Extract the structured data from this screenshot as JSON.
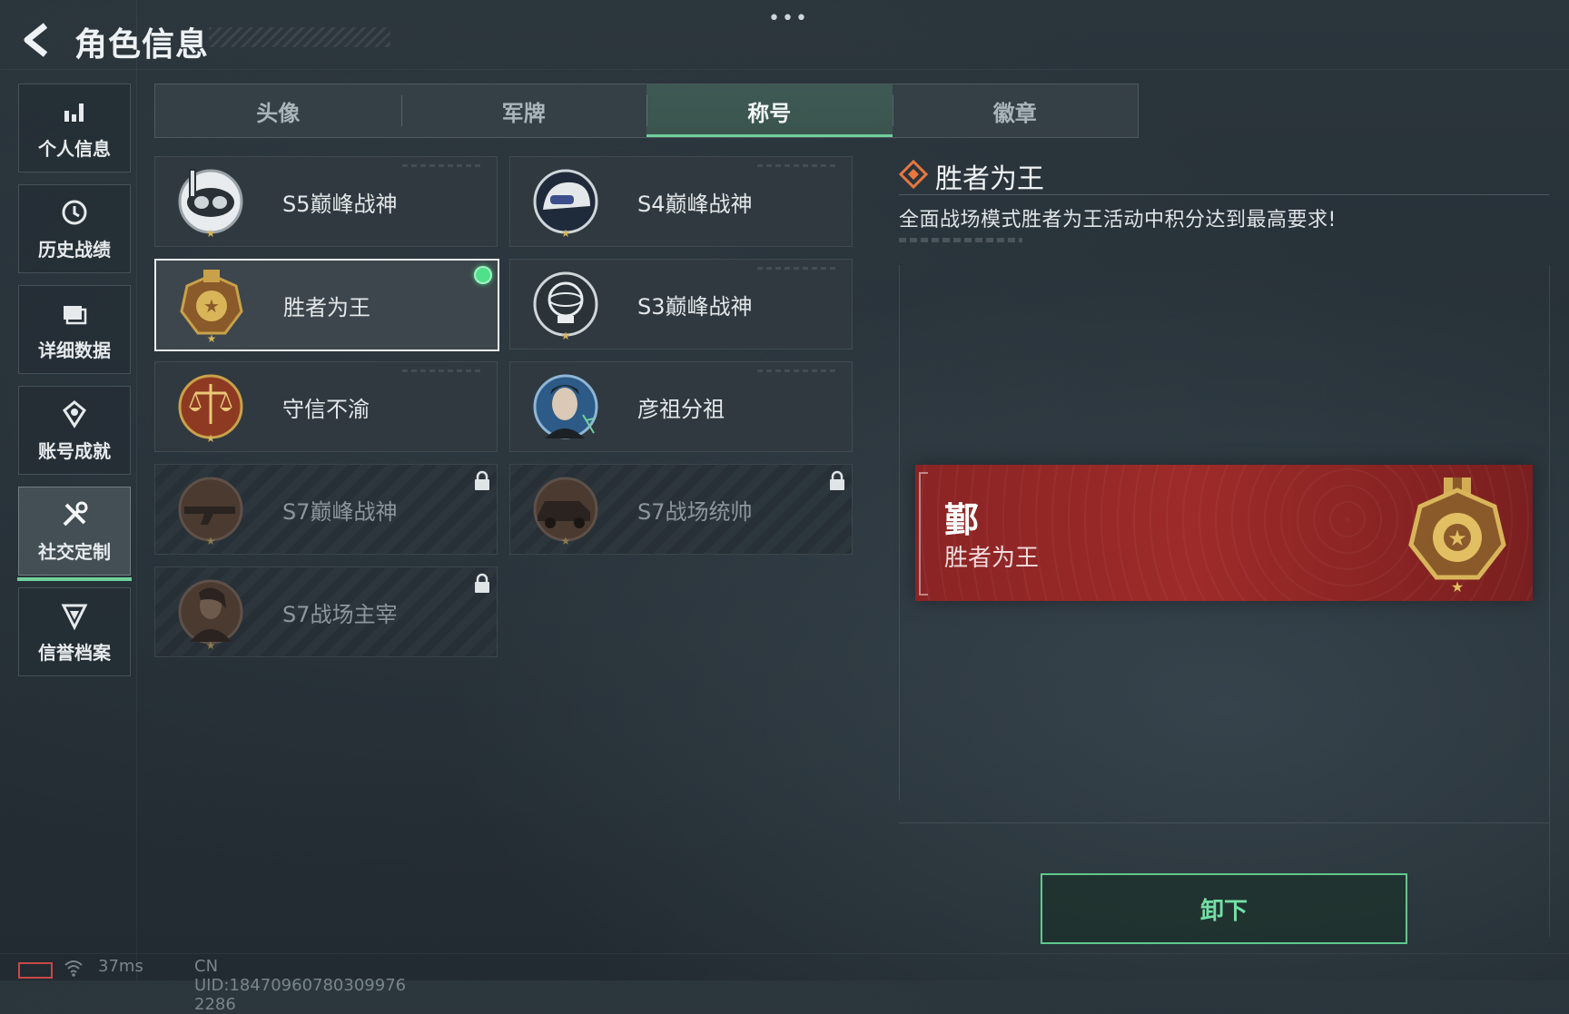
{
  "header": {
    "title": "角色信息"
  },
  "sidebar": {
    "items": [
      {
        "label": "个人信息",
        "icon": "bar-chart-icon",
        "active": false
      },
      {
        "label": "历史战绩",
        "icon": "history-icon",
        "active": false
      },
      {
        "label": "详细数据",
        "icon": "folder-icon",
        "active": false
      },
      {
        "label": "账号成就",
        "icon": "achievement-icon",
        "active": false
      },
      {
        "label": "社交定制",
        "icon": "tools-icon",
        "active": true
      },
      {
        "label": "信誉档案",
        "icon": "credit-icon",
        "active": false
      }
    ]
  },
  "tabs": [
    {
      "label": "头像",
      "active": false
    },
    {
      "label": "军牌",
      "active": false
    },
    {
      "label": "称号",
      "active": true
    },
    {
      "label": "徽章",
      "active": false
    }
  ],
  "titles": [
    {
      "label": "S5巅峰战神",
      "emblem": "diving-mask-emblem",
      "status": "owned"
    },
    {
      "label": "S4巅峰战神",
      "emblem": "helmet-emblem",
      "status": "owned"
    },
    {
      "label": "胜者为王",
      "emblem": "gold-medal-emblem",
      "status": "equipped"
    },
    {
      "label": "S3巅峰战神",
      "emblem": "globe-emblem",
      "status": "owned"
    },
    {
      "label": "守信不渝",
      "emblem": "scales-emblem",
      "status": "owned"
    },
    {
      "label": "彦祖分祖",
      "emblem": "portrait-emblem",
      "status": "owned"
    },
    {
      "label": "S7巅峰战神",
      "emblem": "rifle-emblem",
      "status": "locked"
    },
    {
      "label": "S7战场统帅",
      "emblem": "vehicle-emblem",
      "status": "locked"
    },
    {
      "label": "S7战场主宰",
      "emblem": "warrior-emblem",
      "status": "locked"
    }
  ],
  "detail": {
    "title": "胜者为王",
    "description": "全面战场模式胜者为王活动中积分达到最高要求!"
  },
  "nameplate": {
    "player_name": "鄞",
    "title": "胜者为王"
  },
  "actions": {
    "unequip_label": "卸下"
  },
  "footer": {
    "ping": "37ms",
    "uid": "CN UID:18470960780309976​2286"
  },
  "colors": {
    "accent_green": "#6fd09a",
    "nameplate_red": "#9d2b29",
    "gold": "#c9a14a"
  }
}
